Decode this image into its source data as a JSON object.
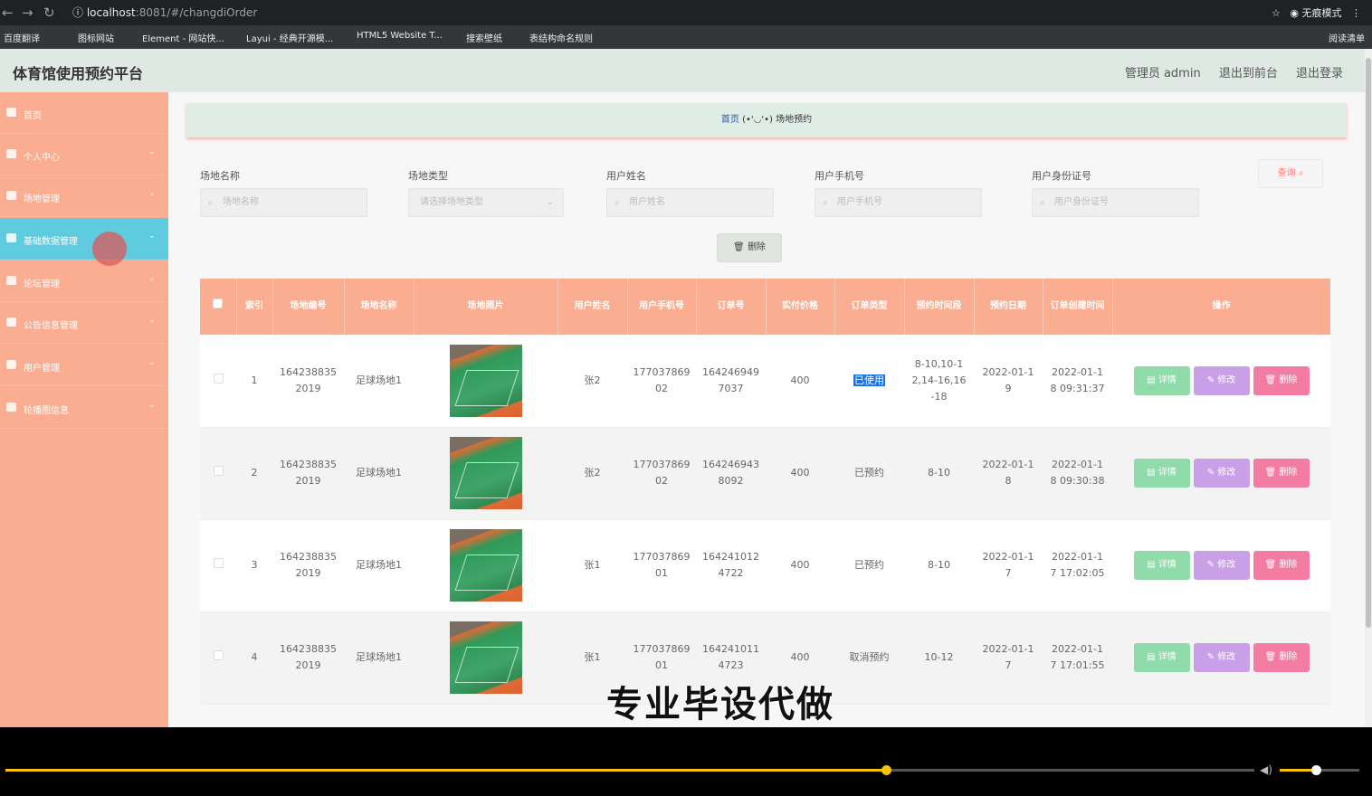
{
  "browser": {
    "url_host": "localhost",
    "url_path": ":8081/#/changdiOrder",
    "profile": "无痕模式",
    "bookmarks": [
      "百度翻译",
      "图标网站",
      "Element - 网站快...",
      "Layui - 经典开源模...",
      "HTML5 Website T...",
      "搜索壁纸",
      "表结构命名规则"
    ],
    "reading_list": "阅读清单"
  },
  "header": {
    "title": "体育馆使用预约平台",
    "admin": "管理员 admin",
    "front": "退出到前台",
    "logout": "退出登录"
  },
  "sidebar": {
    "items": [
      {
        "label": "首页",
        "icon": "home-icon"
      },
      {
        "label": "个人中心",
        "icon": "user-icon"
      },
      {
        "label": "场地管理",
        "icon": "doc-icon"
      },
      {
        "label": "基础数据管理",
        "icon": "shield-icon"
      },
      {
        "label": "论坛管理",
        "icon": "clock-icon"
      },
      {
        "label": "公告信息管理",
        "icon": "settings-icon"
      },
      {
        "label": "用户管理",
        "icon": "users-icon"
      },
      {
        "label": "轮播图信息",
        "icon": "pin-icon"
      }
    ]
  },
  "breadcrumb": {
    "home": "首页",
    "sep": "(•'◡'•)",
    "current": "场地预约"
  },
  "filters": {
    "name": {
      "label": "场地名称",
      "placeholder": "场地名称"
    },
    "type": {
      "label": "场地类型",
      "placeholder": "请选择场地类型"
    },
    "user": {
      "label": "用户姓名",
      "placeholder": "用户姓名"
    },
    "phone": {
      "label": "用户手机号",
      "placeholder": "用户手机号"
    },
    "idcard": {
      "label": "用户身份证号",
      "placeholder": "用户身份证号"
    },
    "query": "查询",
    "delete": "删除"
  },
  "table": {
    "headers": [
      "索引",
      "场地编号",
      "场地名称",
      "场地照片",
      "用户姓名",
      "用户手机号",
      "订单号",
      "实付价格",
      "订单类型",
      "预约时间段",
      "预约日期",
      "订单创建时间",
      "操作"
    ],
    "actions": {
      "detail": "详情",
      "edit": "修改",
      "delete": "删除"
    },
    "rows": [
      {
        "idx": "1",
        "code": "164238835\n2019",
        "name": "足球场地1",
        "user": "张2",
        "phone": "177037869\n02",
        "order": "164246949\n7037",
        "price": "400",
        "type": "已使用",
        "slot": "8-10,10-1\n2,14-16,16\n-18",
        "date": "2022-01-1\n9",
        "created": "2022-01-1\n8 09:31:37"
      },
      {
        "idx": "2",
        "code": "164238835\n2019",
        "name": "足球场地1",
        "user": "张2",
        "phone": "177037869\n02",
        "order": "164246943\n8092",
        "price": "400",
        "type": "已预约",
        "slot": "8-10",
        "date": "2022-01-1\n8",
        "created": "2022-01-1\n8 09:30:38"
      },
      {
        "idx": "3",
        "code": "164238835\n2019",
        "name": "足球场地1",
        "user": "张1",
        "phone": "177037869\n01",
        "order": "164241012\n4722",
        "price": "400",
        "type": "已预约",
        "slot": "8-10",
        "date": "2022-01-1\n7",
        "created": "2022-01-1\n7 17:02:05"
      },
      {
        "idx": "4",
        "code": "164238835\n2019",
        "name": "足球场地1",
        "user": "张1",
        "phone": "177037869\n01",
        "order": "164241011\n4723",
        "price": "400",
        "type": "取消预约",
        "slot": "10-12",
        "date": "2022-01-1\n7",
        "created": "2022-01-1\n7 17:01:55"
      }
    ]
  },
  "watermark": "专业毕设代做",
  "player": {
    "progress": 0.705,
    "volume": 0.45
  },
  "colors": {
    "sidebar": "#fbad92",
    "active": "#5ecbde",
    "header_bar": "#dfe9e4",
    "progress": "#f5c400"
  }
}
